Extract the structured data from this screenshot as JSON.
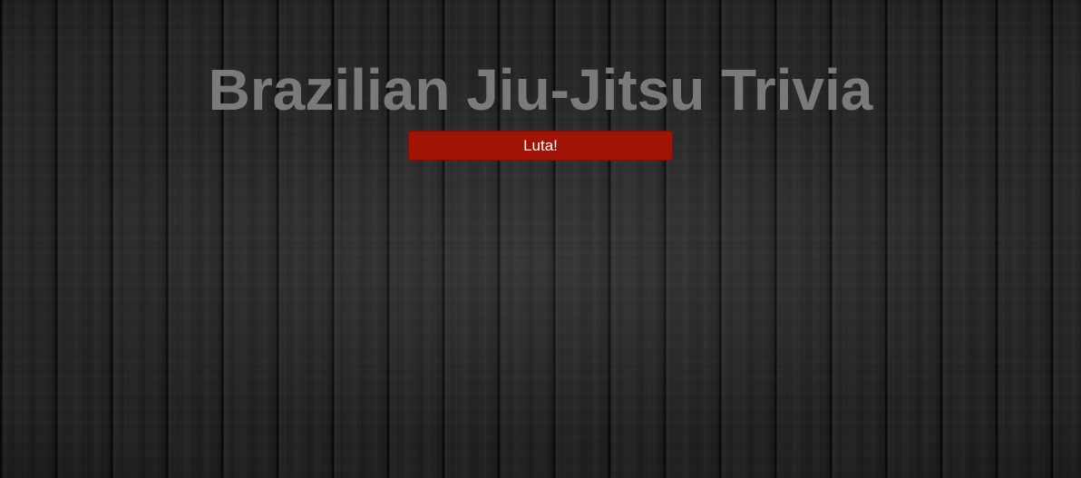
{
  "page": {
    "title": "Brazilian Jiu-Jitsu Trivia",
    "start_button_label": "Luta!"
  },
  "colors": {
    "title": "#7a7a7a",
    "button_bg": "#a01406",
    "button_text": "#ffffff",
    "background": "#1f1f1f"
  }
}
